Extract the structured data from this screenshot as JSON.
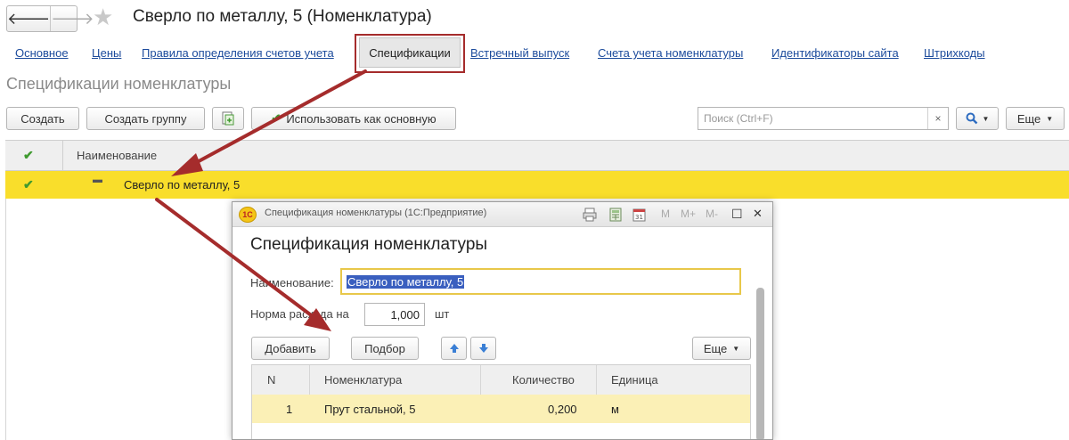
{
  "header": {
    "title": "Сверло по металлу, 5 (Номенклатура)",
    "back_glyph": "🡐",
    "forward_glyph": "🡒",
    "star_glyph": "★"
  },
  "tabs": [
    {
      "label": "Основное"
    },
    {
      "label": "Цены"
    },
    {
      "label": "Правила определения счетов учета"
    },
    {
      "label": "Спецификации",
      "active": true
    },
    {
      "label": "Встречный выпуск"
    },
    {
      "label": "Счета учета номенклатуры"
    },
    {
      "label": "Идентификаторы сайта"
    },
    {
      "label": "Штрихкоды"
    }
  ],
  "section_title": "Спецификации номенклатуры",
  "toolbar": {
    "create_label": "Создать",
    "create_group_label": "Создать группу",
    "use_as_main_label": "Использовать как основную",
    "search_placeholder": "Поиск (Ctrl+F)",
    "clear_glyph": "×",
    "more_label": "Еще"
  },
  "list": {
    "header_check": "✔",
    "header_name": "Наименование",
    "rows": [
      {
        "check": "✔",
        "marker": "▬",
        "name": "Сверло по металлу, 5"
      }
    ]
  },
  "dialog": {
    "window_title": "Спецификация номенклатуры  (1С:Предприятие)",
    "logo_text": "1С",
    "heading": "Спецификация номенклатуры",
    "name_label": "Наименование:",
    "name_value": "Сверло по металлу, 5",
    "rate_label": "Норма расхода на",
    "rate_value": "1,000",
    "rate_unit": "шт",
    "add_label": "Добавить",
    "select_label": "Подбор",
    "more_label": "Еще",
    "titlebar_icons": {
      "m": "M",
      "mplus": "M+",
      "mminus": "M-",
      "maximize": "☐",
      "close": "✕"
    },
    "table": {
      "headers": [
        "N",
        "Номенклатура",
        "Количество",
        "Единица"
      ],
      "rows": [
        {
          "n": "1",
          "item": "Прут стальной, 5",
          "qty": "0,200",
          "unit": "м"
        }
      ]
    }
  },
  "colors": {
    "highlight_row": "#f9de2b",
    "annotation_red": "#a52c2c",
    "link_blue": "#1c4b9c",
    "check_green": "#3f9a2f",
    "dialog_row": "#fbf0b6"
  }
}
